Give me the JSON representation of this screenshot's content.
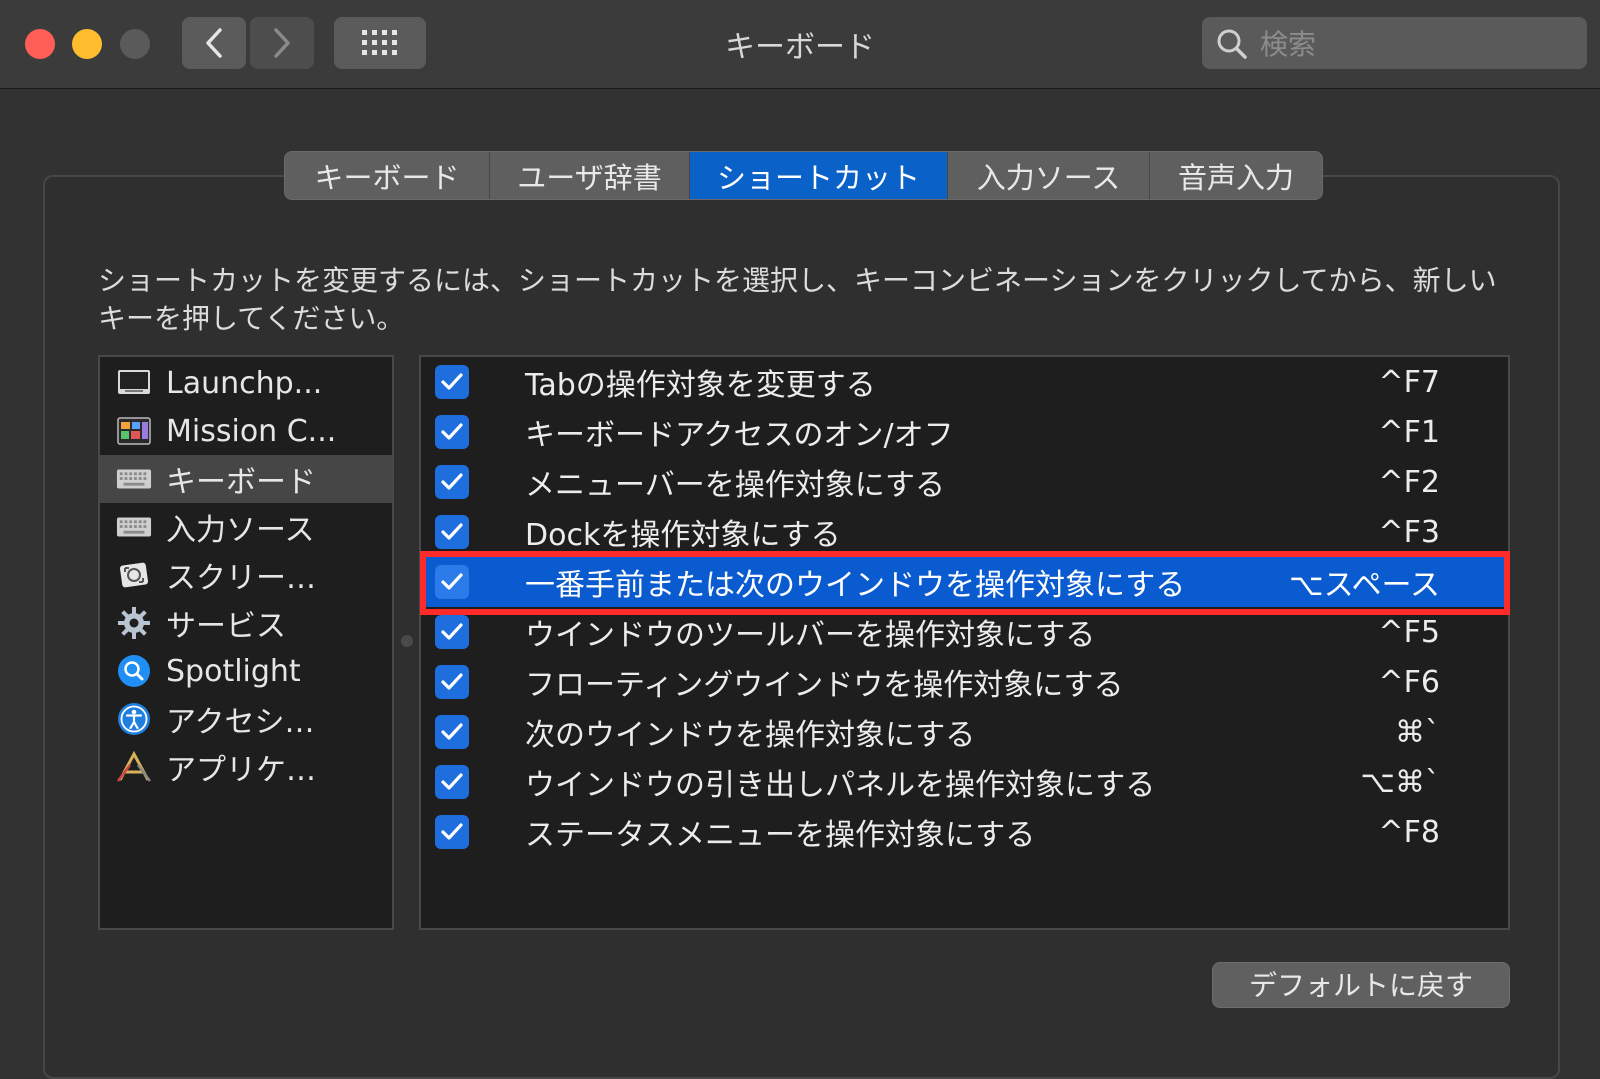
{
  "window": {
    "title": "キーボード",
    "search_placeholder": "検索"
  },
  "tabs": [
    {
      "label": "キーボード"
    },
    {
      "label": "ユーザ辞書"
    },
    {
      "label": "ショートカット",
      "active": true
    },
    {
      "label": "入力ソース"
    },
    {
      "label": "音声入力"
    }
  ],
  "instruction": "ショートカットを変更するには、ショートカットを選択し、キーコンビネーションをクリックしてから、新しいキーを押してください。",
  "categories": [
    {
      "label": "Launchp...",
      "icon": "launchpad-icon"
    },
    {
      "label": "Mission C...",
      "icon": "mission-control-icon"
    },
    {
      "label": "キーボード",
      "icon": "keyboard-icon",
      "selected": true
    },
    {
      "label": "入力ソース",
      "icon": "input-source-icon"
    },
    {
      "label": "スクリー…",
      "icon": "screenshot-icon"
    },
    {
      "label": "サービス",
      "icon": "gear-icon"
    },
    {
      "label": "Spotlight",
      "icon": "spotlight-icon"
    },
    {
      "label": "アクセシ…",
      "icon": "accessibility-icon"
    },
    {
      "label": "アプリケ…",
      "icon": "app-shortcuts-icon"
    }
  ],
  "shortcuts": [
    {
      "label": "Tabの操作対象を変更する",
      "key": "^F7",
      "checked": true
    },
    {
      "label": "キーボードアクセスのオン/オフ",
      "key": "^F1",
      "checked": true
    },
    {
      "label": "メニューバーを操作対象にする",
      "key": "^F2",
      "checked": true
    },
    {
      "label": "Dockを操作対象にする",
      "key": "^F3",
      "checked": true
    },
    {
      "label": "一番手前または次のウインドウを操作対象にする",
      "key": "⌥スペース",
      "checked": true,
      "selected": true
    },
    {
      "label": "ウインドウのツールバーを操作対象にする",
      "key": "^F5",
      "checked": true
    },
    {
      "label": "フローティングウインドウを操作対象にする",
      "key": "^F6",
      "checked": true
    },
    {
      "label": "次のウインドウを操作対象にする",
      "key": "⌘`",
      "checked": true
    },
    {
      "label": "ウインドウの引き出しパネルを操作対象にする",
      "key": "⌥⌘`",
      "checked": true
    },
    {
      "label": "ステータスメニューを操作対象にする",
      "key": "^F8",
      "checked": true
    }
  ],
  "buttons": {
    "restore_defaults": "デフォルトに戻す"
  },
  "colors": {
    "accent": "#0a62c9",
    "selection": "#0a5bd0",
    "highlight_border": "#ff2a2a"
  }
}
